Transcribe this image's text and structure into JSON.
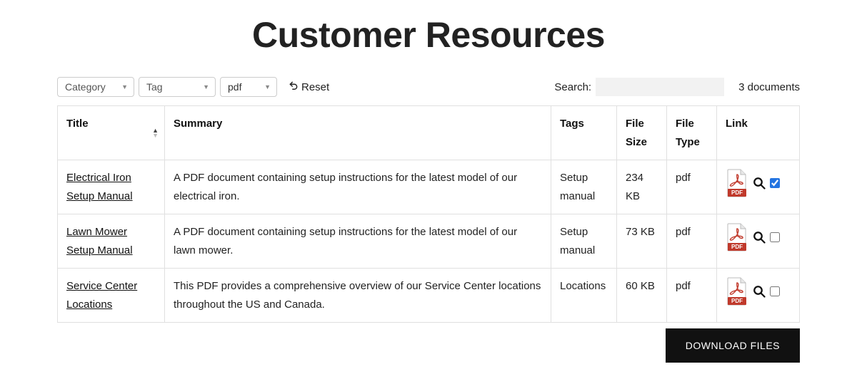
{
  "header": {
    "title": "Customer Resources"
  },
  "filters": {
    "category_label": "Category",
    "tag_label": "Tag",
    "filetype_value": "pdf",
    "reset_label": "Reset"
  },
  "search": {
    "label": "Search:",
    "value": ""
  },
  "doc_count": "3 documents",
  "columns": {
    "title": "Title",
    "summary": "Summary",
    "tags": "Tags",
    "file_size": "File Size",
    "file_type": "File Type",
    "link": "Link"
  },
  "rows": [
    {
      "title": "Electrical Iron Setup Manual",
      "summary": "A PDF document containing setup instructions for the latest model of our electrical iron.",
      "tags": "Setup manual",
      "file_size": "234 KB",
      "file_type": "pdf",
      "checked": true
    },
    {
      "title": "Lawn Mower Setup Manual",
      "summary": "A PDF document containing setup instructions for the latest model of our lawn mower.",
      "tags": "Setup manual",
      "file_size": "73 KB",
      "file_type": "pdf",
      "checked": false
    },
    {
      "title": "Service Center Locations",
      "summary": "This PDF provides a comprehensive overview of our Service Center locations throughout the US and Canada.",
      "tags": "Locations",
      "file_size": "60 KB",
      "file_type": "pdf",
      "checked": false
    }
  ],
  "download_label": "DOWNLOAD FILES"
}
